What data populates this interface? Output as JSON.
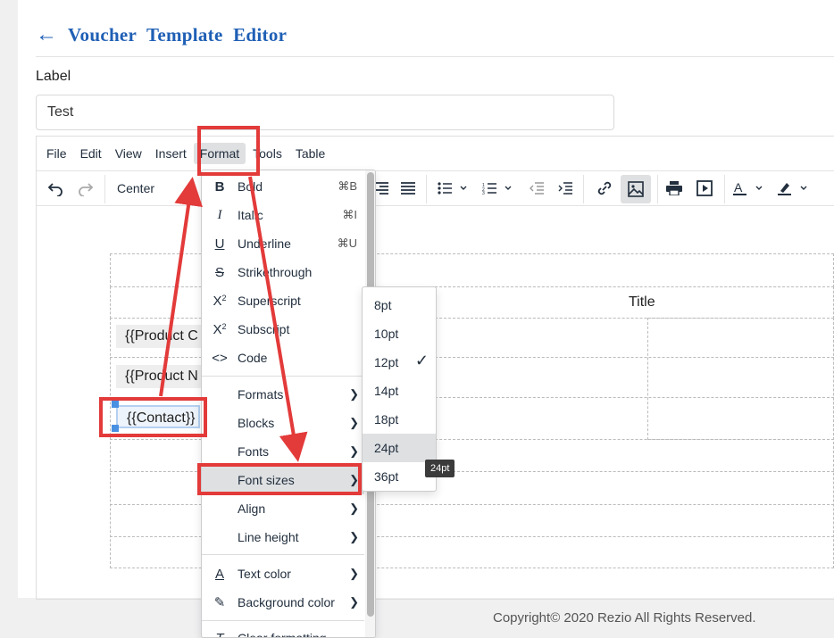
{
  "header": {
    "back_icon": "arrow-left-icon",
    "title": "Voucher Template Editor"
  },
  "form": {
    "label": "Label",
    "label_value": "Test"
  },
  "editor": {
    "menubar": [
      "File",
      "Edit",
      "View",
      "Insert",
      "Format",
      "Tools",
      "Table"
    ],
    "toolbar": {
      "alignment": "Center"
    }
  },
  "content": {
    "title": "Title",
    "chips": [
      "{{Product C",
      "{{Product N",
      "{{Contact}}"
    ]
  },
  "format_menu": {
    "items": [
      {
        "label": "Bold",
        "icon": "bold-icon",
        "shortcut": "⌘B"
      },
      {
        "label": "Italic",
        "icon": "italic-icon",
        "shortcut": "⌘I"
      },
      {
        "label": "Underline",
        "icon": "underline-icon",
        "shortcut": "⌘U"
      },
      {
        "label": "Strikethrough",
        "icon": "strikethrough-icon",
        "shortcut": ""
      },
      {
        "label": "Superscript",
        "icon": "superscript-icon",
        "shortcut": ""
      },
      {
        "label": "Subscript",
        "icon": "subscript-icon",
        "shortcut": ""
      },
      {
        "label": "Code",
        "icon": "code-icon",
        "shortcut": ""
      },
      {
        "label": "Formats",
        "icon": "",
        "shortcut": ""
      },
      {
        "label": "Blocks",
        "icon": "",
        "shortcut": ""
      },
      {
        "label": "Fonts",
        "icon": "",
        "shortcut": ""
      },
      {
        "label": "Font sizes",
        "icon": "",
        "shortcut": ""
      },
      {
        "label": "Align",
        "icon": "",
        "shortcut": ""
      },
      {
        "label": "Line height",
        "icon": "",
        "shortcut": ""
      },
      {
        "label": "Text color",
        "icon": "text-color-icon",
        "shortcut": ""
      },
      {
        "label": "Background color",
        "icon": "background-color-icon",
        "shortcut": ""
      },
      {
        "label": "Clear formatting",
        "icon": "clear-formatting-icon",
        "shortcut": ""
      }
    ]
  },
  "font_sizes": {
    "options": [
      "8pt",
      "10pt",
      "12pt",
      "14pt",
      "18pt",
      "24pt",
      "36pt"
    ],
    "checked": "12pt",
    "hovered": "24pt",
    "tooltip": "24pt"
  },
  "colors": {
    "title": "#1f5fb5",
    "annotation": "#e33a3a",
    "hover": "#dee0e2"
  },
  "footer": {
    "copyright": "Copyright© 2020 Rezio All Rights Reserved."
  }
}
